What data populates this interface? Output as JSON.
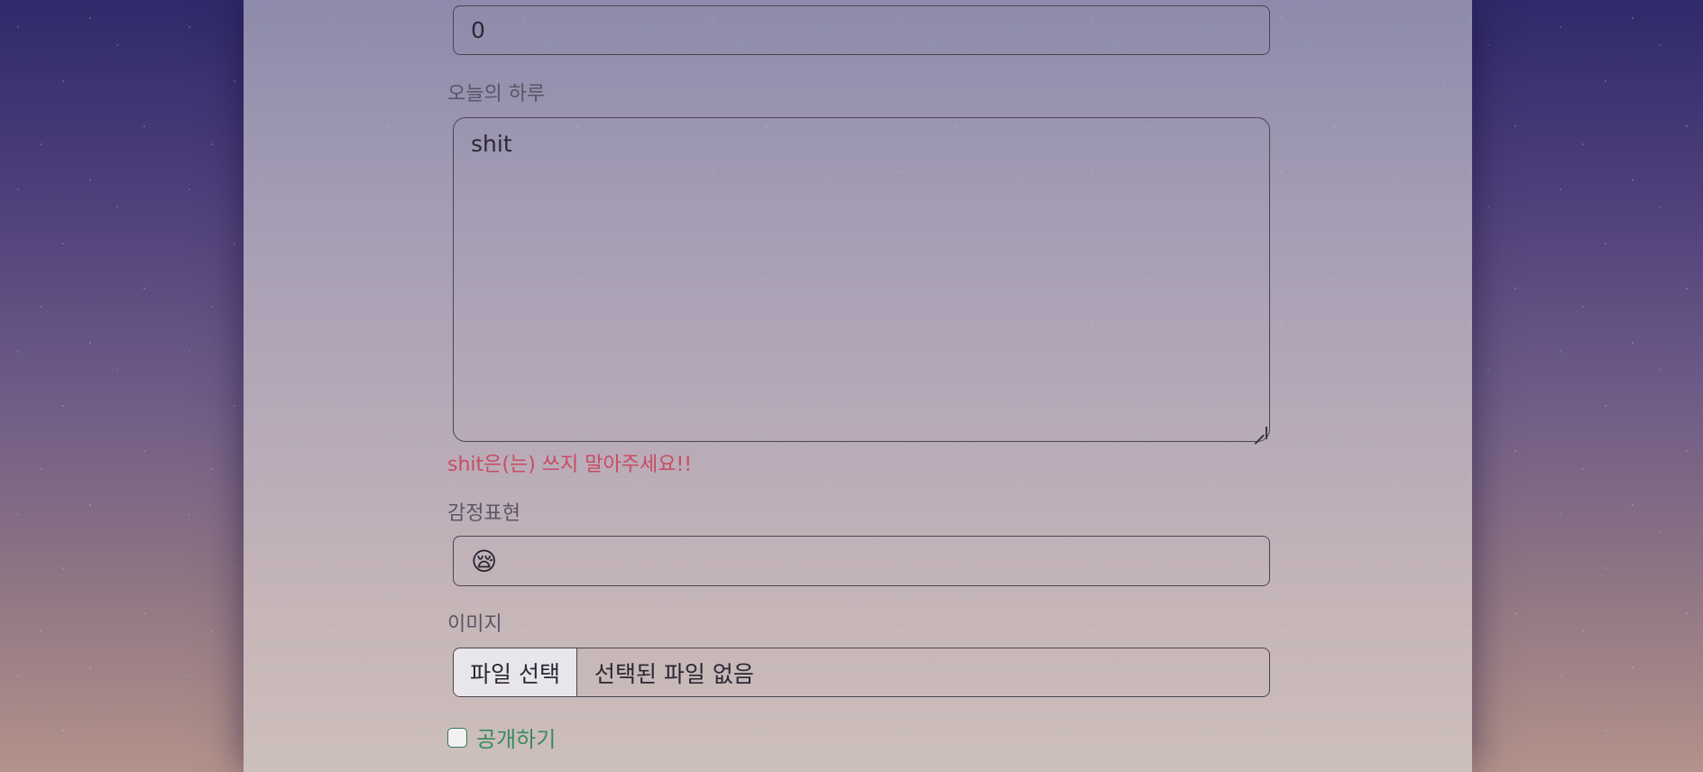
{
  "form": {
    "number_value": "0",
    "diary_label": "오늘의 하루",
    "diary_value": "shit",
    "error_message": "shit은(는) 쓰지 말아주세요!!",
    "emotion_label": "감정표현",
    "emotion_value": "😪",
    "image_label": "이미지",
    "file_button_label": "파일 선택",
    "file_status": "선택된 파일 없음",
    "public_label": "공개하기",
    "public_checked": false
  },
  "colors": {
    "error": "#c94b63",
    "accent_green": "#3a8a5e"
  }
}
